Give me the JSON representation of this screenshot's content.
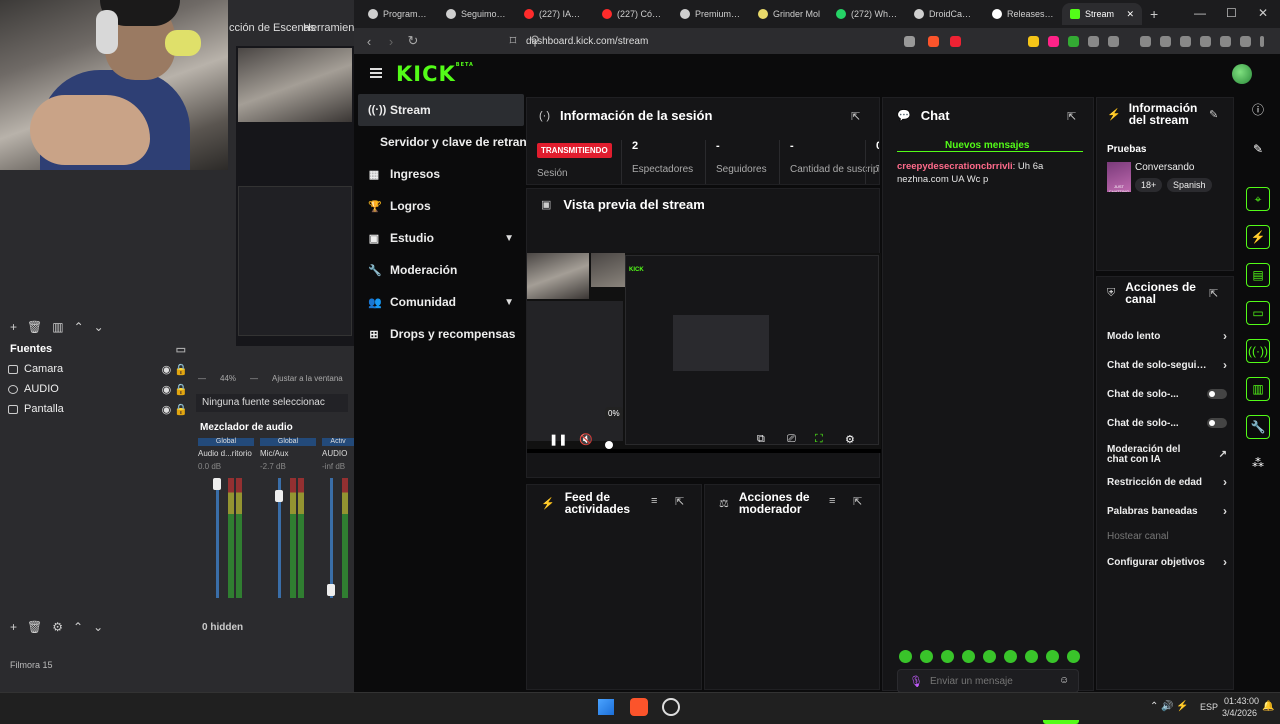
{
  "obs": {
    "menu_escenas": "cción de Escenas",
    "menu_herramientas": "Herramienta",
    "fuentes_title": "Fuentes",
    "sources": [
      {
        "name": "Camara"
      },
      {
        "name": "AUDIO"
      },
      {
        "name": "Pantalla"
      }
    ],
    "no_source_text": "Ninguna fuente seleccionac",
    "zoom": "44%",
    "fit_label": "Ajustar a la ventana",
    "mixer_title": "Mezclador de audio",
    "mixer_channels": [
      {
        "global": "Global",
        "name": "Audio d...ritorio",
        "db": "0.0 dB"
      },
      {
        "global": "Global",
        "name": "Mic/Aux",
        "db": "-2.7 dB"
      },
      {
        "global": "Activ",
        "name": "AUDIO",
        "db": "-inf dB"
      }
    ],
    "hidden_label": "0 hidden",
    "filmora_label": "Filmora 15"
  },
  "browser": {
    "tabs": [
      {
        "label": "Programas e",
        "color": "#cfcfcf"
      },
      {
        "label": "Seguimos ad",
        "color": "#cfcfcf"
      },
      {
        "label": "(227) IAmCh",
        "color": "#ff2b2b"
      },
      {
        "label": "(227) Cómo",
        "color": "#ff2b2b"
      },
      {
        "label": "Premium Alli",
        "color": "#cfcfcf"
      },
      {
        "label": "Grinder Mol",
        "color": "#e8d96a"
      },
      {
        "label": "(272) Whats",
        "color": "#25d366"
      },
      {
        "label": "DroidCam C",
        "color": "#cfcfcf"
      },
      {
        "label": "Releases · dr",
        "color": "#ffffff"
      },
      {
        "label": "Stream",
        "color": "#53fc18"
      }
    ],
    "url": "dashboard.kick.com/stream"
  },
  "kick": {
    "logo": "KICK",
    "logo_beta": "BETA",
    "sidebar": [
      {
        "label": "Stream",
        "icon": "broadcast-icon"
      },
      {
        "label": "Servidor y clave de retransn",
        "icon": ""
      },
      {
        "label": "Ingresos",
        "icon": "income-icon"
      },
      {
        "label": "Logros",
        "icon": "trophy-icon"
      },
      {
        "label": "Estudio",
        "icon": "studio-icon"
      },
      {
        "label": "Moderación",
        "icon": "wrench-icon"
      },
      {
        "label": "Comunidad",
        "icon": "people-icon"
      },
      {
        "label": "Drops y recompensas",
        "icon": "gift-icon"
      }
    ],
    "session": {
      "title": "Información de la sesión",
      "live_badge": "TRANSMITIENDO",
      "session_label": "Sesión",
      "stats": [
        {
          "value": "2",
          "label": "Espectadores"
        },
        {
          "value": "-",
          "label": "Seguidores"
        },
        {
          "value": "-",
          "label": "Cantidad de suscripciones"
        },
        {
          "value": "0",
          "label": "T"
        }
      ]
    },
    "preview": {
      "title": "Vista previa del stream",
      "volume_tooltip": "0%"
    },
    "feed": {
      "title": "Feed de actividades"
    },
    "mod_actions": {
      "title": "Acciones de moderador"
    },
    "chat": {
      "title": "Chat",
      "new_messages": "Nuevos mensajes",
      "messages": [
        {
          "user": "creepydesecrationcbrrivli",
          "text": ": Uh 6a nezhna.com UA Wc p"
        }
      ],
      "input_placeholder": "Enviar un mensaje",
      "send_label": "Chat"
    },
    "stream_info": {
      "title": "Información del stream",
      "stream_title": "Pruebas",
      "category": "Conversando",
      "tags": [
        "18+",
        "Spanish"
      ],
      "category_thumb_text": "JUST CHATTING"
    },
    "channel_actions": {
      "title": "Acciones de canal",
      "items": [
        {
          "label": "Modo lento",
          "control": "chevron"
        },
        {
          "label": "Chat de solo-seguidores",
          "control": "chevron"
        },
        {
          "label": "Chat de solo-...",
          "control": "toggle"
        },
        {
          "label": "Chat de solo-...",
          "control": "toggle"
        },
        {
          "label": "Moderación del chat con IA",
          "control": "external"
        },
        {
          "label": "Restricción de edad",
          "control": "chevron"
        },
        {
          "label": "Palabras baneadas",
          "control": "chevron"
        },
        {
          "label": "Hostear canal",
          "control": "none"
        },
        {
          "label": "Configurar objetivos",
          "control": "chevron"
        }
      ]
    }
  },
  "taskbar": {
    "lang": "ESP",
    "time": "01:43:00",
    "date": "3/4/2026"
  }
}
